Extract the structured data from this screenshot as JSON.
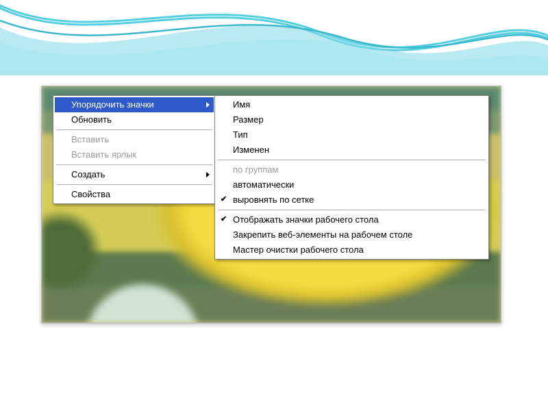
{
  "main_menu": {
    "arrange_icons": "Упорядочить значки",
    "refresh": "Обновить",
    "paste": "Вставить",
    "paste_shortcut": "Вставить ярлык",
    "create": "Создать",
    "properties": "Свойства"
  },
  "sub_menu": {
    "name": "Имя",
    "size": "Размер",
    "type": "Тип",
    "modified": "Изменен",
    "by_groups": "по группам",
    "auto": "автоматически",
    "align_grid": "выровнять по сетке",
    "show_desktop_icons": "Отображать значки рабочего стола",
    "lock_web_items": "Закрепить веб-элементы на рабочем столе",
    "cleanup_wizard": "Мастер очистки рабочего стола"
  }
}
